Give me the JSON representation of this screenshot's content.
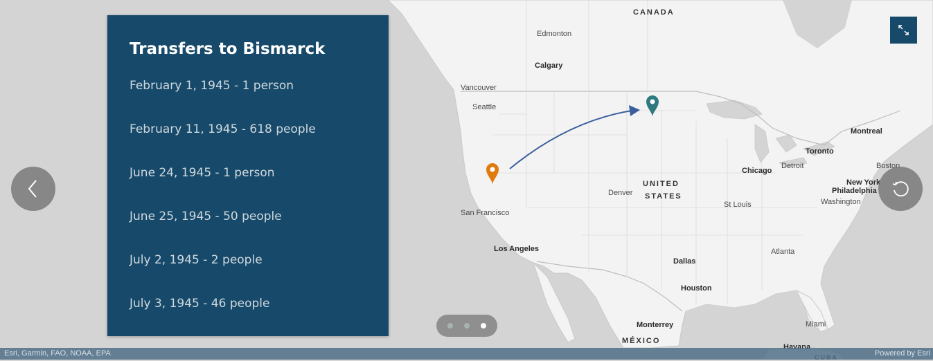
{
  "panel": {
    "title": "Transfers to Bismarck",
    "entries": [
      "February 1, 1945 - 1 person",
      "February 11, 1945 - 618 people",
      "June 24, 1945 - 1 person",
      "June 25, 1945 - 50 people",
      "July 2, 1945 - 2 people",
      "July 3, 1945 - 46 people"
    ],
    "background_color": "#174a6a"
  },
  "map": {
    "labels": {
      "canada": "CANADA",
      "edmonton": "Edmonton",
      "calgary": "Calgary",
      "vancouver": "Vancouver",
      "seattle": "Seattle",
      "montreal": "Montreal",
      "toronto": "Toronto",
      "detroit": "Detroit",
      "chicago": "Chicago",
      "boston": "Boston",
      "new_york_line1": "New York",
      "philadelphia": "Philadelphia",
      "washington": "Washington",
      "united_line1": "UNITED",
      "states_line2": "STATES",
      "denver": "Denver",
      "st_louis": "St Louis",
      "san_francisco": "San Francisco",
      "los_angeles": "Los Angeles",
      "atlanta": "Atlanta",
      "dallas": "Dallas",
      "houston": "Houston",
      "monterrey": "Monterrey",
      "miami": "Miami",
      "mexico": "MÉXICO",
      "havana": "Havana",
      "cuba": "CUBA"
    },
    "markers": {
      "origin_color": "#e07b10",
      "destination_color": "#2e7a80",
      "arrow_color": "#3a5f9c"
    }
  },
  "attribution": {
    "sources": "Esri, Garmin, FAO, NOAA, EPA",
    "powered_by": "Powered by Esri"
  },
  "navigation": {
    "previous_icon": "chevron-left-icon",
    "restart_icon": "restart-icon",
    "expand_icon": "expand-icon",
    "page_count": 3,
    "active_page": 3
  }
}
